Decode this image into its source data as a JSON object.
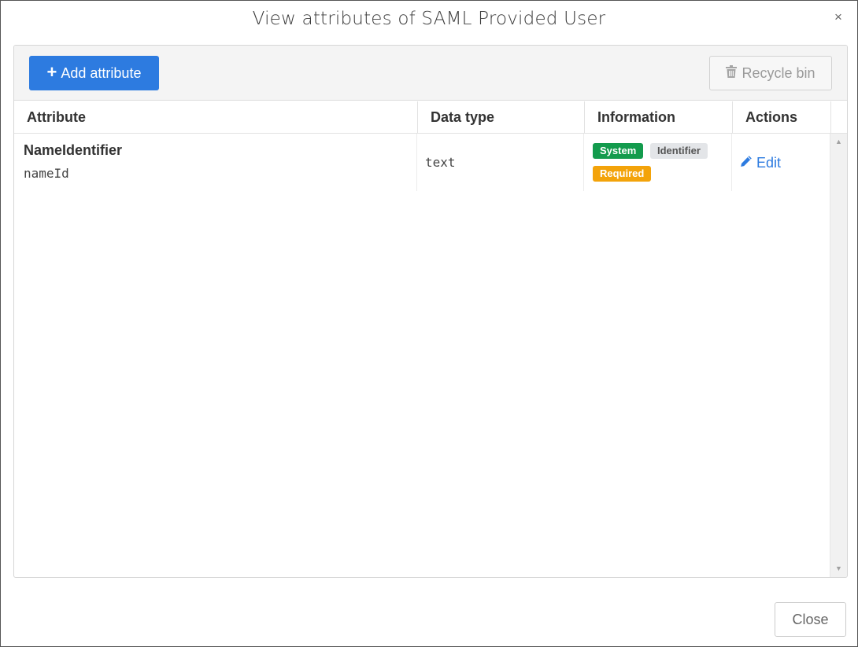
{
  "dialog": {
    "title": "View attributes of SAML Provided User",
    "close_glyph": "×"
  },
  "toolbar": {
    "add_icon": "plus-icon",
    "add_label": "Add attribute",
    "recycle_icon": "trash-icon",
    "recycle_label": "Recycle bin"
  },
  "table": {
    "columns": [
      "Attribute",
      "Data type",
      "Information",
      "Actions"
    ],
    "rows": [
      {
        "name": "NameIdentifier",
        "key": "nameId",
        "data_type": "text",
        "badges": [
          "System",
          "Identifier",
          "Required"
        ],
        "action_label": "Edit",
        "action_icon": "pencil-icon"
      }
    ]
  },
  "footer": {
    "close_label": "Close"
  },
  "colors": {
    "primary": "#2d7be0",
    "badge_system": "#139b4d",
    "badge_identifier": "#e3e5e8",
    "badge_required": "#f3a30a"
  }
}
